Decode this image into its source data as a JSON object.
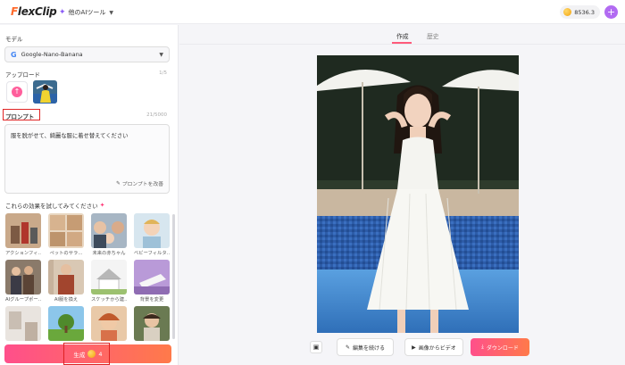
{
  "header": {
    "logo_mark": "F",
    "logo_rest": "lexClip",
    "tools_label": "他のAIツール",
    "credits": "8536.3",
    "avatar_initial": "+"
  },
  "left": {
    "model_label": "モデル",
    "model_value": "Google-Nano-Banana",
    "upload_label": "アップロード",
    "upload_count": "1/5",
    "prompt_label": "プロンプト",
    "prompt_count": "21/5000",
    "prompt_text": "服を脱がせて、綺麗な服に着せ替えてください",
    "improve_label": "プロンプトを改善",
    "effects_label": "これらの効果を試してみてください",
    "effects": [
      {
        "caption": "アクションフィ…"
      },
      {
        "caption": "ペットのサラ…"
      },
      {
        "caption": "未来の赤ちゃん"
      },
      {
        "caption": "ベビーフィルタ…"
      },
      {
        "caption": "AIグループポー…"
      },
      {
        "caption": "AI服を換え"
      },
      {
        "caption": "スケッチから建…"
      },
      {
        "caption": "背景を変更"
      },
      {
        "caption": ""
      },
      {
        "caption": ""
      },
      {
        "caption": ""
      },
      {
        "caption": ""
      }
    ],
    "generate_label": "生成",
    "generate_cost": "4"
  },
  "right": {
    "tab_create": "作成",
    "tab_history": "歴史",
    "continue_label": "編集を続ける",
    "video_label": "画像からビデオ",
    "download_label": "ダウンロード"
  },
  "colors": {
    "accent_pink": "#ff4f8b",
    "accent_orange": "#ff7a4a",
    "highlight_red": "#e02424"
  }
}
